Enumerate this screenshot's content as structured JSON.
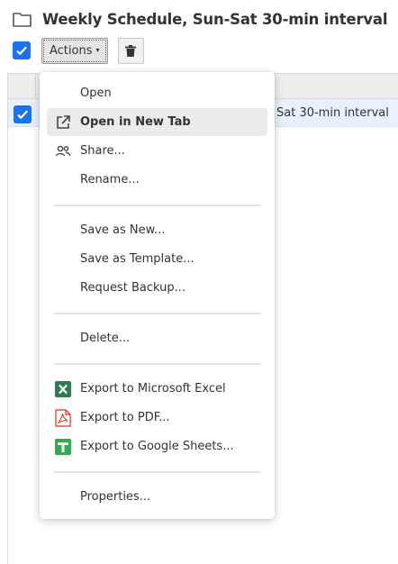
{
  "header": {
    "title": "Weekly Schedule, Sun-Sat 30-min interval",
    "icon": "folder-icon"
  },
  "toolbar": {
    "actions_label": "Actions",
    "caret": "▾",
    "trash_icon": "trash-icon"
  },
  "table": {
    "rows": [
      {
        "name": "Sat 30-min interval",
        "selected": true
      }
    ]
  },
  "menu": {
    "items": [
      {
        "label": "Open",
        "icon": ""
      },
      {
        "label": "Open in New Tab",
        "icon": "external-link-icon",
        "highlighted": true
      },
      {
        "label": "Share...",
        "icon": "users-icon"
      },
      {
        "label": "Rename...",
        "icon": ""
      },
      {
        "label": "Save as New...",
        "icon": ""
      },
      {
        "label": "Save as Template...",
        "icon": ""
      },
      {
        "label": "Request Backup...",
        "icon": ""
      },
      {
        "label": "Delete...",
        "icon": ""
      },
      {
        "label": "Export to Microsoft Excel",
        "icon": "excel-icon"
      },
      {
        "label": "Export to PDF...",
        "icon": "pdf-icon"
      },
      {
        "label": "Export to Google Sheets...",
        "icon": "google-sheets-icon"
      },
      {
        "label": "Properties...",
        "icon": ""
      }
    ]
  },
  "colors": {
    "accent": "#1a73e8",
    "excel": "#2e7d4f",
    "pdf": "#d93025",
    "sheets": "#34a853",
    "row_selected": "#e7f0fc"
  }
}
